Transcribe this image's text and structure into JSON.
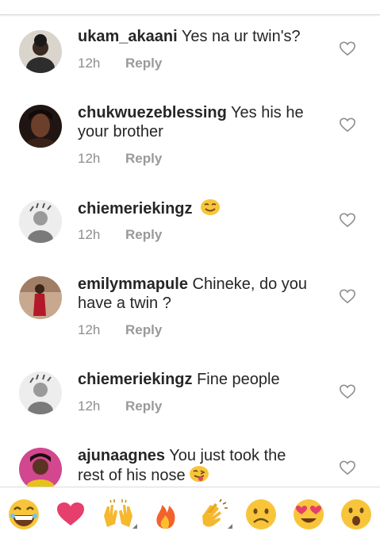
{
  "comments": [
    {
      "username": "ukam_akaani",
      "text": "Yes na ur twin's?",
      "time": "12h",
      "reply_label": "Reply",
      "emoji": ""
    },
    {
      "username": "chukwuezeblessing",
      "text": "Yes his he your brother",
      "time": "12h",
      "reply_label": "Reply",
      "emoji": ""
    },
    {
      "username": "chiemeriekingz",
      "text": "",
      "time": "12h",
      "reply_label": "Reply",
      "emoji": "smiling-face-icon"
    },
    {
      "username": "emilymmapule",
      "text": "Chineke, do you have a twin ?",
      "time": "12h",
      "reply_label": "Reply",
      "emoji": ""
    },
    {
      "username": "chiemeriekingz",
      "text": "Fine people",
      "time": "12h",
      "reply_label": "Reply",
      "emoji": ""
    },
    {
      "username": "ajunaagnes",
      "text": "You just took the rest of his nose",
      "time": "",
      "reply_label": "",
      "emoji": "tongue-out-face-icon"
    }
  ],
  "emoji_bar": [
    "grinning-face-icon",
    "red-heart-icon",
    "raised-hands-icon",
    "fire-icon",
    "clapping-hands-icon",
    "frowning-face-icon",
    "heart-eyes-face-icon",
    "surprised-face-icon"
  ],
  "colors": {
    "text": "#262626",
    "muted": "#8e8e8e",
    "divider": "#dbdbdb",
    "background": "#ffffff"
  }
}
